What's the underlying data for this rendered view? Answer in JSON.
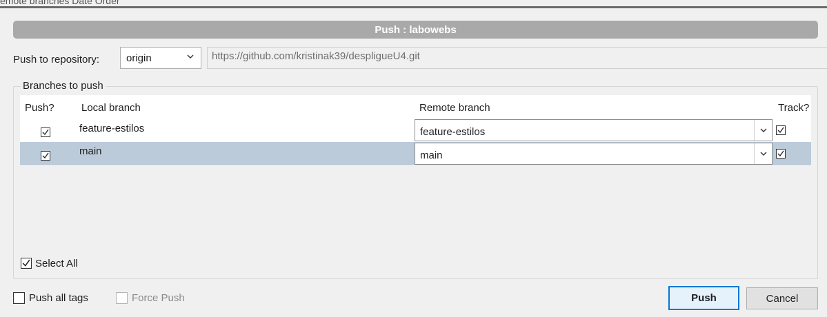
{
  "background": {
    "text": "emote branches    Date Order"
  },
  "dialog": {
    "title": "Push : labowebs"
  },
  "repository": {
    "label": "Push to repository:",
    "selected": "origin",
    "url": "https://github.com/kristinak39/despligueU4.git"
  },
  "branches": {
    "group_label": "Branches to push",
    "columns": {
      "push": "Push?",
      "local": "Local branch",
      "remote": "Remote branch",
      "track": "Track?"
    },
    "rows": [
      {
        "local": "feature-estilos",
        "remote": "feature-estilos",
        "push": true,
        "track": true,
        "selected": false
      },
      {
        "local": "main",
        "remote": "main",
        "push": true,
        "track": true,
        "selected": true
      }
    ],
    "select_all_label": "Select All"
  },
  "options": {
    "push_all_tags_label": "Push all tags",
    "force_push_label": "Force Push"
  },
  "buttons": {
    "push_label": "Push",
    "cancel_label": "Cancel"
  },
  "colors": {
    "title_bar": "#a9a9a9",
    "selected_row": "#bccbda",
    "default_button_border": "#0078d7"
  }
}
